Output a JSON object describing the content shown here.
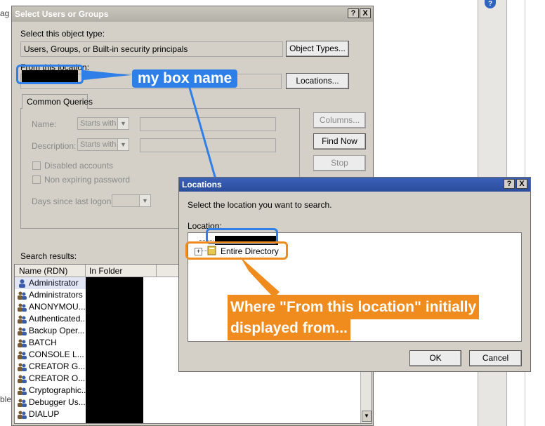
{
  "background": {
    "partial_left_text": "ag",
    "partial_left_text2": "ble",
    "help_icon": "help-icon"
  },
  "select_dialog": {
    "title": "Select Users or Groups",
    "object_type_label": "Select this object type:",
    "object_type_value": "Users, Groups, or Built-in security principals",
    "object_types_button": "Object Types...",
    "location_label": "From this location:",
    "locations_button": "Locations...",
    "tab_label": "Common Queries",
    "name_label": "Name:",
    "description_label": "Description:",
    "starts_with": "Starts with",
    "disabled_accounts": "Disabled accounts",
    "non_expiring_password": "Non expiring password",
    "days_since_logon": "Days since last logon:",
    "columns_button": "Columns...",
    "find_now_button": "Find Now",
    "stop_button": "Stop",
    "search_results_label": "Search results:",
    "columns": [
      "Name (RDN)",
      "In Folder"
    ],
    "results": [
      "Administrator",
      "Administrators",
      "ANONYMOU...",
      "Authenticated...",
      "Backup Oper...",
      "BATCH",
      "CONSOLE L...",
      "CREATOR G...",
      "CREATOR O...",
      "Cryptographic...",
      "Debugger Us...",
      "DIALUP"
    ]
  },
  "locations_dialog": {
    "title": "Locations",
    "prompt": "Select the location you want to search.",
    "location_label": "Location:",
    "tree_item": "Entire Directory",
    "ok_button": "OK",
    "cancel_button": "Cancel"
  },
  "annotations": {
    "blue_label": "my box name",
    "orange_line1": "Where \"From this location\" initially",
    "orange_line2": "displayed from...",
    "blue_color": "#2e7fe8",
    "orange_color": "#f08c1e"
  },
  "title_buttons": {
    "help": "?",
    "close": "X"
  }
}
